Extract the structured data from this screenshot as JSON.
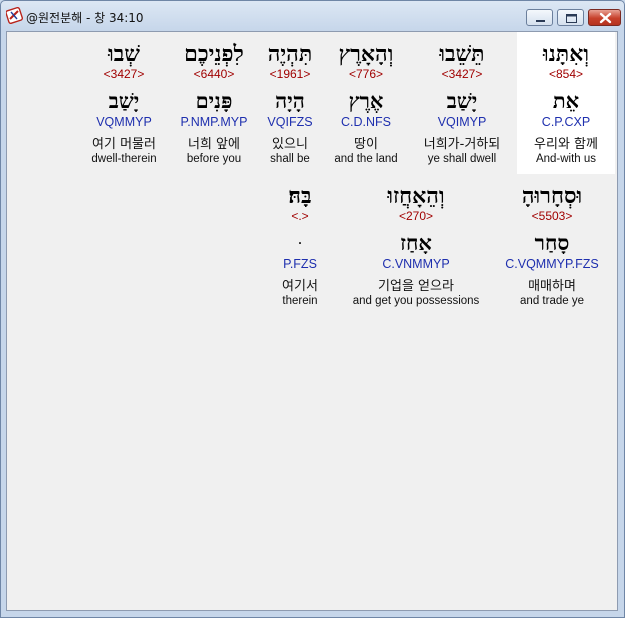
{
  "window": {
    "title": "@원전분해 - 창 34:10",
    "icon": "app-logo-icon",
    "buttons": [
      "minimize-icon",
      "maximize-icon",
      "close-icon"
    ]
  },
  "row1": [
    {
      "hebrew": "וְאִתָּנוּ",
      "strong": "<854>",
      "lemma": "אֵת",
      "morph": "C.P.CXP",
      "korean": "우리와 함께",
      "english": "And-with us",
      "selected": true
    },
    {
      "hebrew": "תֵּשֵׁבוּ",
      "strong": "<3427>",
      "lemma": "יָשַׁב",
      "morph": "VQIMYP",
      "korean": "너희가-거하되",
      "english": "ye shall dwell"
    },
    {
      "hebrew": "וְהָאָרֶץ",
      "strong": "<776>",
      "lemma": "אֶרֶץ",
      "morph": "C.D.NFS",
      "korean": "땅이",
      "english": "and the land"
    },
    {
      "hebrew": "תִּהְיֶה",
      "strong": "<1961>",
      "lemma": "הָיָה",
      "morph": "VQIFZS",
      "korean": "있으니",
      "english": "shall be"
    },
    {
      "hebrew": "לִפְנֵיכֶם",
      "strong": "<6440>",
      "lemma": "פָּנִים",
      "morph": "P.NMP.MYP",
      "korean": "너희 앞에",
      "english": "before you"
    },
    {
      "hebrew": "שְׁבוּ",
      "strong": "<3427>",
      "lemma": "יָשַׁב",
      "morph": "VQMMYP",
      "korean": "여기 머물러",
      "english": "dwell-therein"
    }
  ],
  "row2": [
    {
      "hebrew": "וּסְחָרוּהָ",
      "strong": "<5503>",
      "lemma": "סָחַר",
      "morph": "C.VQMMYP.FZS",
      "korean": "매매하며",
      "english": "and trade ye"
    },
    {
      "hebrew": "וְהֵאָחֲזוּ",
      "strong": "<270>",
      "lemma": "אָחַז",
      "morph": "C.VNMMYP",
      "korean": "기업을 얻으라",
      "english": "and get you possessions"
    },
    {
      "hebrew": "בָּהּ׃",
      "strong": "<.>",
      "lemma": "ּ",
      "morph": "P.FZS",
      "korean": "여기서",
      "english": "therein"
    }
  ],
  "colors": {
    "strong": "#a00000",
    "morph": "#1e2fae",
    "client_background": "#f0f0f0",
    "selected_background": "#ffffff",
    "titlebar": "#c6d6ea",
    "close_button": "#c7402b"
  }
}
